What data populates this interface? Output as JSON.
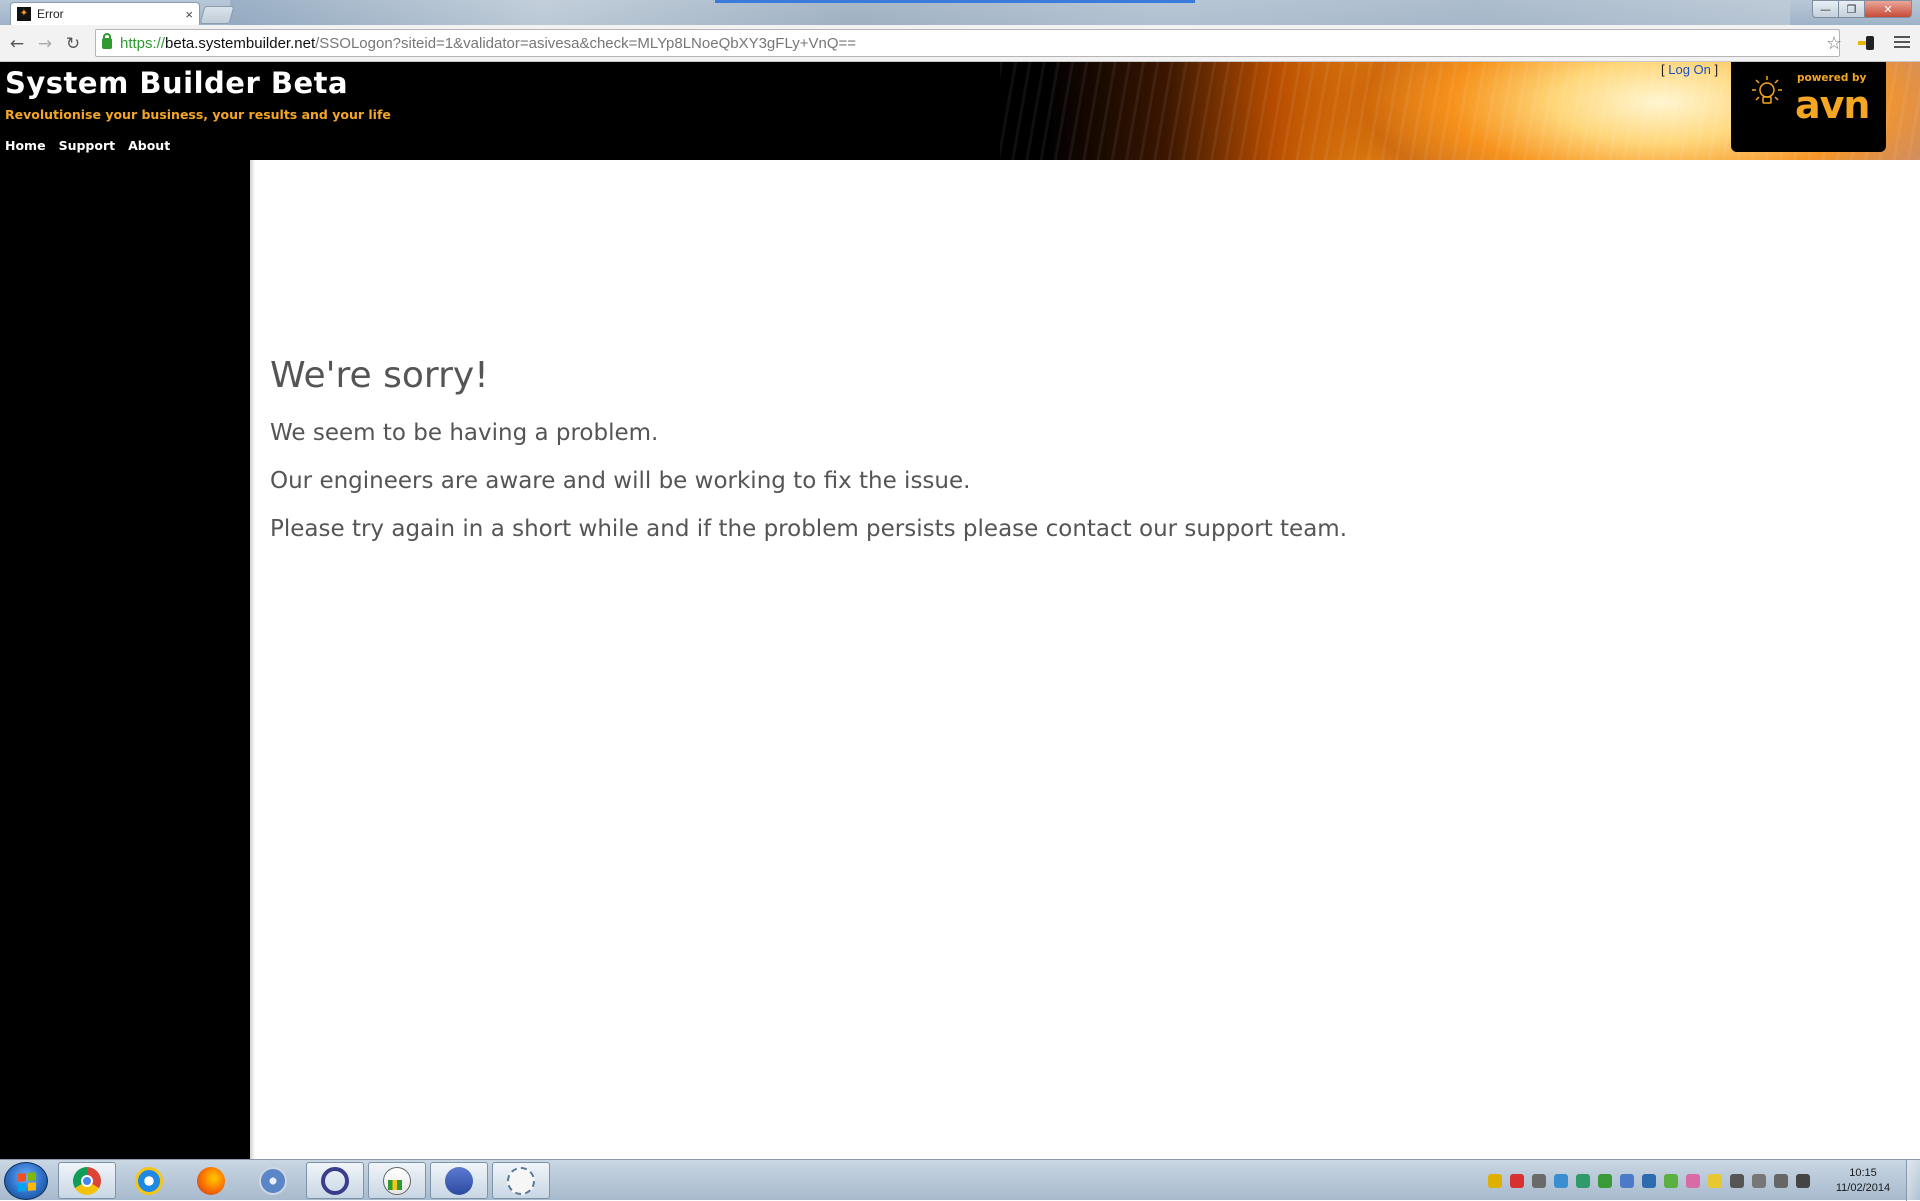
{
  "browser": {
    "tab_title": "Error",
    "tab_close": "×",
    "url_scheme": "https://",
    "url_host": "beta.systembuilder.net",
    "url_path": "/SSOLogon?siteid=1&validator=asivesa&check=MLYp8LNoeQbXY3gFLy+VnQ=="
  },
  "site": {
    "title": "System Builder Beta",
    "tagline": "Revolutionise your business, your results and your life",
    "nav": [
      "Home",
      "Support",
      "About"
    ],
    "logon_open": "[ ",
    "logon_label": "Log On",
    "logon_close": " ]",
    "badge_powered": "powered by",
    "badge_brand": "avn"
  },
  "error": {
    "heading": "We're sorry!",
    "line1": "We seem to be having a problem.",
    "line2": "Our engineers are aware and will be working to fix the issue.",
    "line3": "Please try again in a short while and if the problem persists please contact our support team."
  },
  "taskbar": {
    "time": "10:15",
    "date": "11/02/2014"
  },
  "colors": {
    "accent_orange": "#f5a623",
    "link_blue": "#1a4fc2",
    "text_grey": "#555555"
  }
}
